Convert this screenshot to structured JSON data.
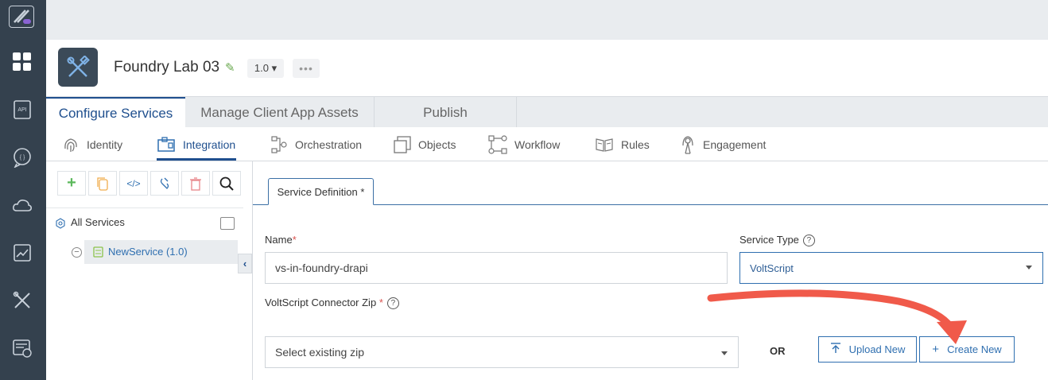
{
  "rail": {
    "icons": [
      "foundry-logo-icon",
      "dashboard-icon",
      "api-icon",
      "chat-icon",
      "cloud-icon",
      "analytics-icon",
      "tools-icon",
      "billing-icon"
    ]
  },
  "app": {
    "name": "Foundry Lab 03",
    "version": "1.0 ▾",
    "more": "•••"
  },
  "main_tabs": [
    {
      "label": "Configure Services",
      "active": true
    },
    {
      "label": "Manage Client App Assets",
      "active": false
    },
    {
      "label": "Publish",
      "active": false
    }
  ],
  "sub_tabs": [
    {
      "label": "Identity",
      "icon": "fingerprint-icon"
    },
    {
      "label": "Integration",
      "icon": "integration-icon",
      "active": true
    },
    {
      "label": "Orchestration",
      "icon": "orchestration-icon"
    },
    {
      "label": "Objects",
      "icon": "objects-icon"
    },
    {
      "label": "Workflow",
      "icon": "workflow-icon"
    },
    {
      "label": "Rules",
      "icon": "rules-icon"
    },
    {
      "label": "Engagement",
      "icon": "engagement-icon"
    }
  ],
  "left_panel": {
    "tree_root": "All Services",
    "service": "NewService (1.0)"
  },
  "form": {
    "tab_label": "Service Definition",
    "tab_modified": "*",
    "name_label": "Name",
    "name_required": "*",
    "name_value": "vs-in-foundry-drapi",
    "service_type_label": "Service Type",
    "service_type_value": "VoltScript",
    "help": "?",
    "zip_label": "VoltScript Connector Zip",
    "zip_required": "*",
    "zip_select": "Select existing zip",
    "or_label": "OR",
    "upload_label": "Upload New",
    "create_label": "Create New"
  },
  "colors": {
    "rail": "#34414e",
    "accent": "#1f4f8e",
    "annotation_arrow": "#f05a4a"
  }
}
